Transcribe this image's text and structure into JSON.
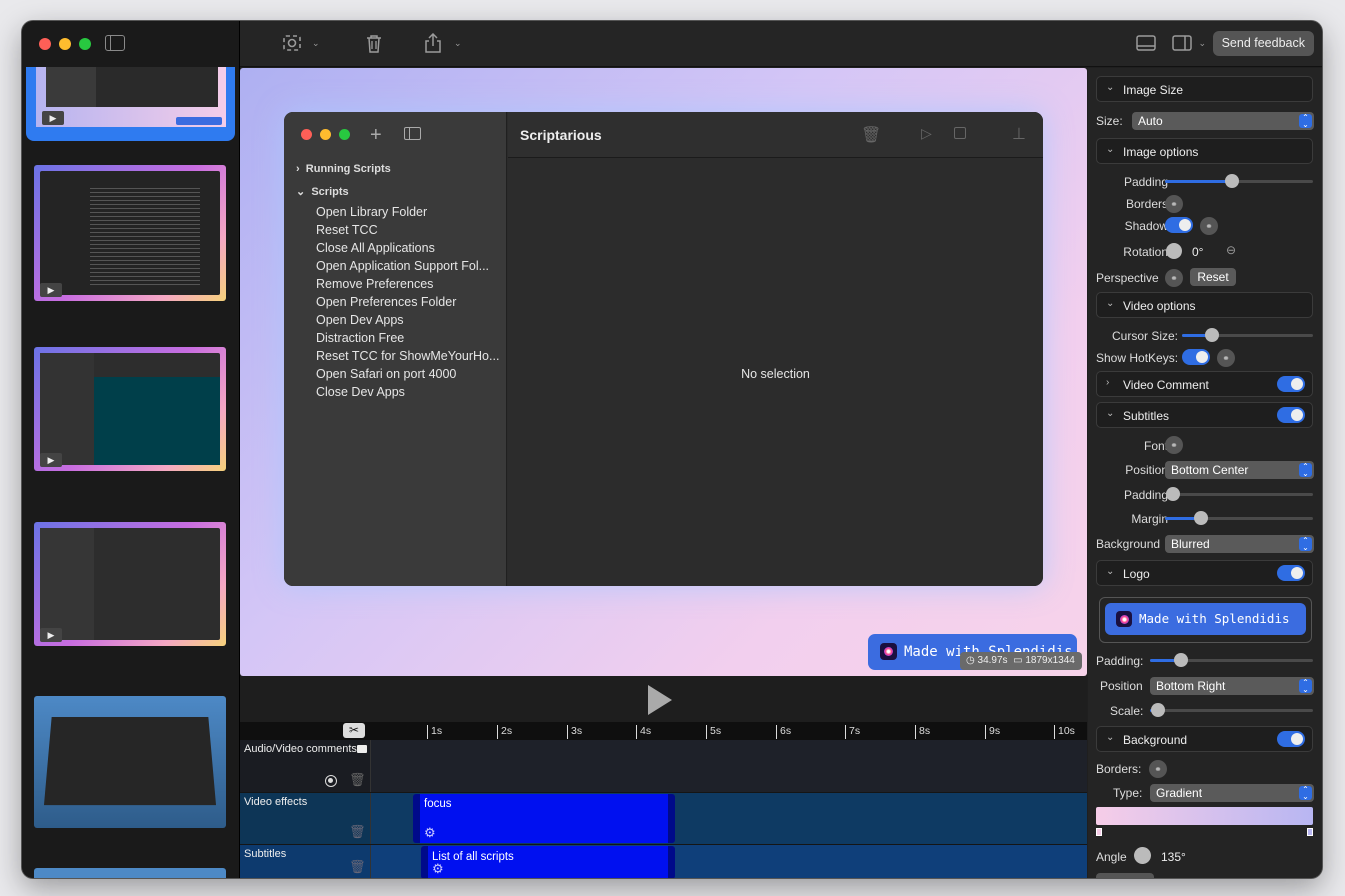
{
  "toolbar": {
    "feedback_label": "Send feedback"
  },
  "canvas": {
    "inner_title": "Scriptarious",
    "running_scripts": "Running Scripts",
    "scripts_header": "Scripts",
    "scripts": [
      "Open Library Folder",
      "Reset TCC",
      "Close All Applications",
      "Open Application Support Fol...",
      "Remove Preferences",
      "Open Preferences Folder",
      "Open Dev Apps",
      "Distraction Free",
      "Reset TCC for ShowMeYourHo...",
      "Open Safari on port 4000",
      "Close Dev Apps"
    ],
    "empty_state": "No selection",
    "badge_text": "Made with Splendidis",
    "duration": "34.97s",
    "resolution": "1879x1344"
  },
  "timeline": {
    "ticks": [
      "1s",
      "2s",
      "3s",
      "4s",
      "5s",
      "6s",
      "7s",
      "8s",
      "9s",
      "10s"
    ],
    "tracks": {
      "comments": "Audio/Video comments",
      "effects": "Video effects",
      "subtitles": "Subtitles"
    },
    "clips": {
      "focus": "focus",
      "subtitle": "List of all scripts"
    }
  },
  "inspector": {
    "image_size": "Image Size",
    "size_label": "Size:",
    "size_value": "Auto",
    "image_options": "Image options",
    "padding": "Padding",
    "borders": "Borders",
    "shadow": "Shadow",
    "rotation": "Rotation",
    "rotation_value": "0°",
    "perspective": "Perspective",
    "reset": "Reset",
    "video_options": "Video options",
    "cursor_size": "Cursor Size:",
    "show_hotkeys": "Show HotKeys:",
    "video_comment": "Video Comment",
    "subtitles": "Subtitles",
    "font": "Font",
    "position": "Position",
    "position_value": "Bottom Center",
    "sub_padding": "Padding",
    "margin": "Margin",
    "background_label": "Background",
    "background_value": "Blurred",
    "logo": "Logo",
    "logo_text": "Made with Splendidis",
    "logo_padding": "Padding:",
    "logo_position": "Position",
    "logo_position_value": "Bottom Right",
    "scale": "Scale:",
    "background_section": "Background",
    "bg_borders": "Borders:",
    "type": "Type:",
    "type_value": "Gradient",
    "angle": "Angle",
    "angle_value": "135°",
    "colors": {
      "accent": "#2f6de3",
      "gradient_start": "#f6cde8",
      "gradient_end": "#b8b6f2"
    },
    "levels": {
      "padding": 0.45,
      "cursor_size": 0.23,
      "sub_padding": 0,
      "margin": 0.24,
      "logo_padding": 0.19,
      "scale": 0.05
    }
  }
}
